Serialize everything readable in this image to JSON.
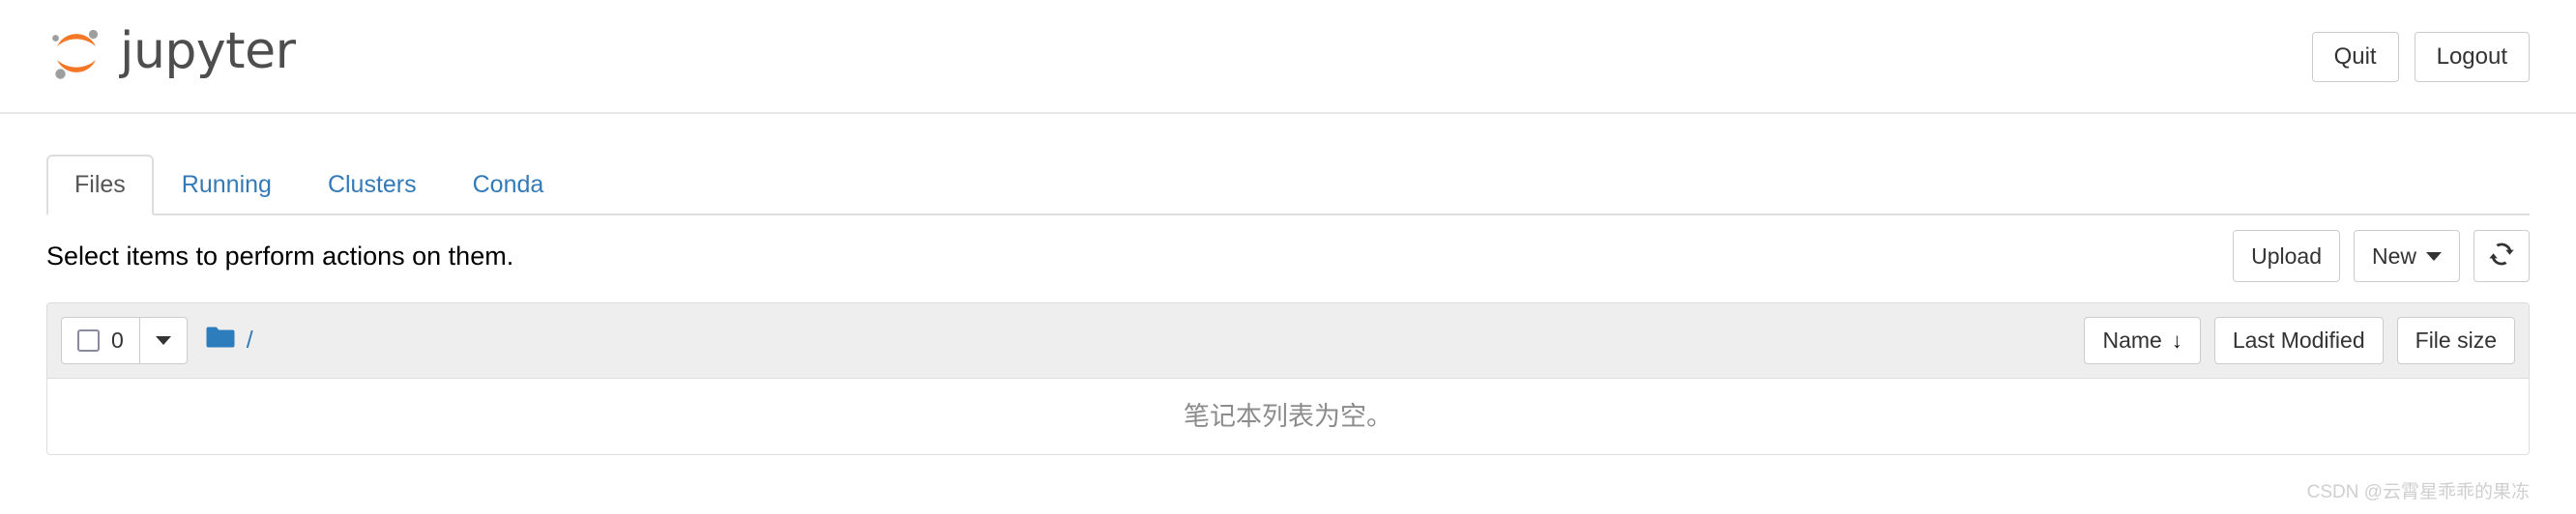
{
  "header": {
    "brand_text": "jupyter",
    "logo_icon": "jupyter-logo",
    "quit_label": "Quit",
    "logout_label": "Logout"
  },
  "tabs": [
    {
      "label": "Files",
      "active": true
    },
    {
      "label": "Running",
      "active": false
    },
    {
      "label": "Clusters",
      "active": false
    },
    {
      "label": "Conda",
      "active": false
    }
  ],
  "action_bar": {
    "hint": "Select items to perform actions on them.",
    "upload_label": "Upload",
    "new_label": "New",
    "new_caret_icon": "chevron-down-icon",
    "refresh_icon": "refresh-icon"
  },
  "file_list": {
    "select_all_count": "0",
    "select_all_checkbox_icon": "checkbox-unchecked-icon",
    "select_dropdown_icon": "chevron-down-icon",
    "folder_icon": "folder-icon",
    "breadcrumb_root": "/",
    "columns": [
      {
        "label": "Name",
        "sort_icon": "↓",
        "sorted": true
      },
      {
        "label": "Last Modified",
        "sort_icon": "",
        "sorted": false
      },
      {
        "label": "File size",
        "sort_icon": "",
        "sorted": false
      }
    ],
    "empty_message": "笔记本列表为空。"
  },
  "watermark": {
    "text": "CSDN @云霄星乖乖的果冻"
  },
  "colors": {
    "brand_orange": "#f37726",
    "brand_gray": "#9e9e9e",
    "link_blue": "#337ab7",
    "folder_blue": "#2d7cbb",
    "toolbar_gray": "#eeeeee",
    "border_gray": "#dddddd"
  }
}
